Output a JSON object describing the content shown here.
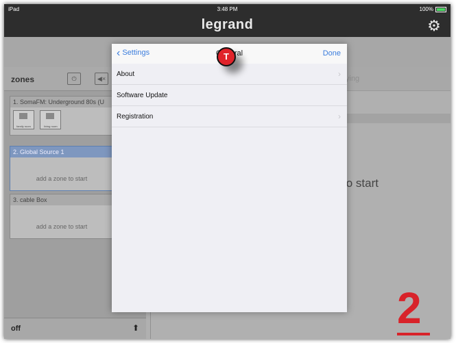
{
  "status": {
    "left": "iPad",
    "time": "3:48 PM",
    "battery": "100%"
  },
  "header": {
    "logo": "legrand"
  },
  "zones": {
    "title": "zones",
    "sources": [
      {
        "name": "1. SomaFM: Underground 80s (U",
        "rooms": [
          "family room",
          "living room"
        ]
      },
      {
        "name": "2. Global Source 1",
        "body": "add a zone to start"
      },
      {
        "name": "3. cable Box",
        "body": "add a zone to start"
      }
    ],
    "off_label": "off"
  },
  "right": {
    "row1": "ying",
    "start": "to start"
  },
  "modal": {
    "back": "Settings",
    "title": "General",
    "done": "Done",
    "rows": [
      "About",
      "Software Update",
      "Registration"
    ]
  },
  "overlay": {
    "badge": "T",
    "step": "2"
  },
  "colors": {
    "accent": "#3b7ddd",
    "badge": "#e0232a",
    "step": "#d8232a"
  }
}
